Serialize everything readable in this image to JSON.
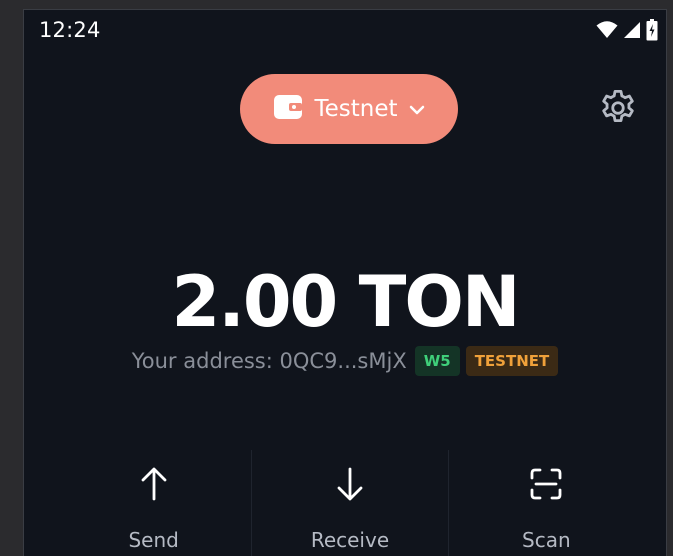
{
  "status_bar": {
    "time": "12:24"
  },
  "header": {
    "network_selector_label": "Testnet",
    "network_selector_color": "#f28b7a"
  },
  "balance": {
    "amount": "2.00 TON"
  },
  "address": {
    "text": "Your address: 0QC9...sMjX",
    "badges": [
      "W5",
      "TESTNET"
    ]
  },
  "actions": [
    {
      "label": "Send",
      "icon": "arrow-up-icon"
    },
    {
      "label": "Receive",
      "icon": "arrow-down-icon"
    },
    {
      "label": "Scan",
      "icon": "scan-icon"
    }
  ],
  "colors": {
    "background": "#10141c",
    "accent": "#f28b7a",
    "badge_w5": "#3fd07a",
    "badge_testnet": "#f0a13a"
  }
}
